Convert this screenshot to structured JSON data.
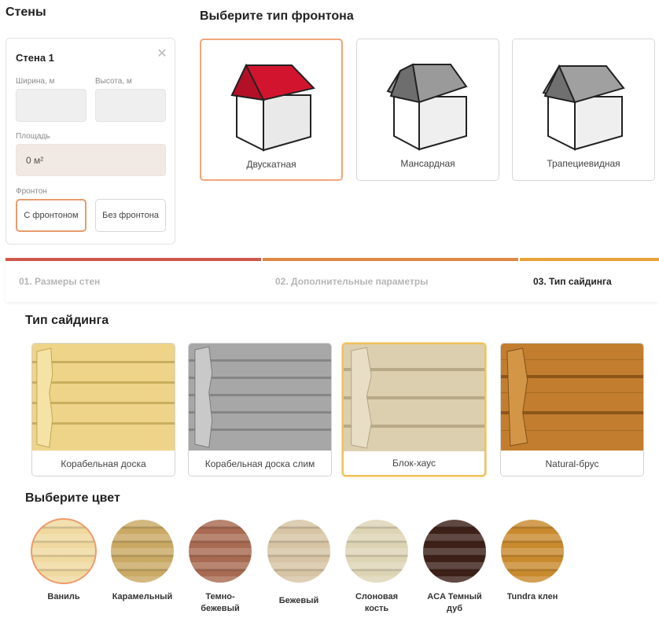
{
  "walls": {
    "title": "Стены",
    "wall_name": "Стена 1",
    "width_label": "Ширина, м",
    "height_label": "Высота, м",
    "width_value": "",
    "height_value": "",
    "area_label": "Площадь",
    "area_value": "0 м²",
    "gable_label": "Фронтон",
    "with_gable": "С фронтоном",
    "without_gable": "Без фронтона",
    "selected_gable_option": "С фронтоном"
  },
  "gable_types": {
    "title": "Выберите тип фронтона",
    "items": [
      {
        "label": "Двускатная",
        "selected": true
      },
      {
        "label": "Мансардная",
        "selected": false
      },
      {
        "label": "Трапециевидная",
        "selected": false
      }
    ]
  },
  "steps": {
    "items": [
      {
        "label": "01. Размеры стен",
        "state": "done"
      },
      {
        "label": "02. Дополнительные параметры",
        "state": "done"
      },
      {
        "label": "03. Тип сайдинга",
        "state": "active"
      }
    ],
    "colors": {
      "step1": "#d0574c",
      "step2": "#de8742",
      "step3": "#e9a237"
    }
  },
  "siding": {
    "title": "Тип сайдинга",
    "items": [
      {
        "label": "Корабельная доска",
        "selected": false
      },
      {
        "label": "Корабельная доска слим",
        "selected": false
      },
      {
        "label": "Блок-хаус",
        "selected": true
      },
      {
        "label": "Natural-брус",
        "selected": false
      }
    ]
  },
  "colors": {
    "title": "Выберите цвет",
    "items": [
      {
        "line1": "Ваниль",
        "line2": "",
        "hex": "#efd9a0",
        "selected": true
      },
      {
        "line1": "Карамельный",
        "line2": "",
        "hex": "#c9a964",
        "selected": false
      },
      {
        "line1": "Темно-",
        "line2": "бежевый",
        "hex": "#a86a52",
        "selected": false
      },
      {
        "line1": "Бежевый",
        "line2": "",
        "hex": "#d6c4a4",
        "selected": false
      },
      {
        "line1": "Слоновая",
        "line2": "кость",
        "hex": "#ddd4b5",
        "selected": false
      },
      {
        "line1": "ACA Темный",
        "line2": "дуб",
        "hex": "#3d2119",
        "selected": false
      },
      {
        "line1": "Tundra клен",
        "line2": "",
        "hex": "#c98a2e",
        "selected": false
      }
    ]
  },
  "accent": "#e99b6f"
}
